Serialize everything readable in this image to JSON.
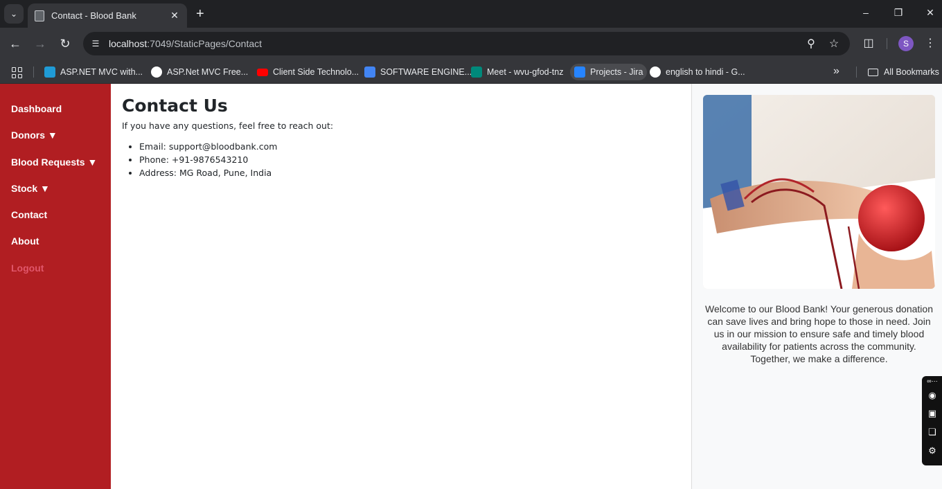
{
  "browser": {
    "tab_title": "Contact - Blood Bank",
    "url_host": "localhost",
    "url_path": ":7049/StaticPages/Contact",
    "profile_initial": "S",
    "bookmarks": [
      "ASP.NET MVC with...",
      "ASP.Net MVC Free...",
      "Client Side Technolo...",
      "SOFTWARE ENGINE...",
      "Meet - wvu-gfod-tnz",
      "Projects - Jira",
      "english to hindi - G..."
    ],
    "all_bookmarks": "All Bookmarks"
  },
  "sidebar": {
    "items": [
      "Dashboard",
      "Donors ▼",
      "Blood Requests ▼",
      "Stock ▼",
      "Contact",
      "About",
      "Logout"
    ]
  },
  "main": {
    "title": "Contact Us",
    "intro": "If you have any questions, feel free to reach out:",
    "contacts": [
      "Email: support@bloodbank.com",
      "Phone: +91-9876543210",
      "Address: MG Road, Pune, India"
    ]
  },
  "rightbar": {
    "welcome": "Welcome to our Blood Bank! Your generous donation can save lives and bring hope to those in need. Join us in our mission to ensure safe and timely blood availability for patients across the community. Together, we make a difference."
  },
  "colors": {
    "sidebar_bg": "#b11e22",
    "logout": "#e0566a",
    "chrome_dark": "#202124",
    "chrome_toolbar": "#35363a"
  }
}
